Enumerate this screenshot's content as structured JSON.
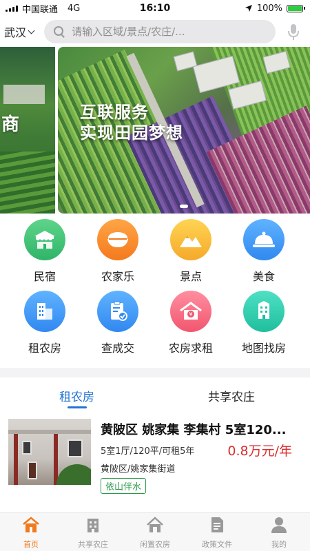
{
  "status_bar": {
    "carrier": "中国联通",
    "network": "4G",
    "time": "16:10",
    "battery": "100%"
  },
  "header": {
    "city": "武汉",
    "search_placeholder": "请输入区域/景点/农庄/...",
    "icons": [
      "search-icon",
      "microphone-icon",
      "chevron-down-icon"
    ]
  },
  "banner": {
    "side_text": "商",
    "title_line1": "互联服务",
    "title_line2": "实现田园梦想",
    "active_slide": 1,
    "slide_count": 2
  },
  "categories": [
    {
      "label": "民宿",
      "icon": "homestay-icon",
      "color": "#2fb568"
    },
    {
      "label": "农家乐",
      "icon": "rice-bowl-icon",
      "color": "#f47a1d"
    },
    {
      "label": "景点",
      "icon": "mountain-icon",
      "color": "#f5a92a"
    },
    {
      "label": "美食",
      "icon": "food-cloche-icon",
      "color": "#3188f0"
    },
    {
      "label": "租农房",
      "icon": "building-icon",
      "color": "#3188f0"
    },
    {
      "label": "查成交",
      "icon": "clipboard-check-icon",
      "color": "#3188f0"
    },
    {
      "label": "农房求租",
      "icon": "house-money-icon",
      "color": "#f1566f"
    },
    {
      "label": "地图找房",
      "icon": "map-building-icon",
      "color": "#1fbf9e"
    }
  ],
  "tabs": [
    {
      "label": "租农房",
      "active": true
    },
    {
      "label": "共享农庄",
      "active": false
    }
  ],
  "listing": {
    "title": "黄陂区 姚家集 李集村 5室120...",
    "specs": "5室1厅/120平/可租5年",
    "price": "0.8万元/年",
    "address": "黄陂区/姚家集街道",
    "tag": "依山伴水"
  },
  "bottom_nav": [
    {
      "label": "首页",
      "icon": "home-icon",
      "active": true
    },
    {
      "label": "共享农庄",
      "icon": "farm-building-icon",
      "active": false
    },
    {
      "label": "闲置农房",
      "icon": "house-icon",
      "active": false
    },
    {
      "label": "政策文件",
      "icon": "document-icon",
      "active": false
    },
    {
      "label": "我的",
      "icon": "profile-icon",
      "active": false
    }
  ],
  "colors": {
    "accent_blue": "#2273d6",
    "price_red": "#d9302f",
    "tag_green": "#2a9a4a",
    "nav_active": "#f07a1d"
  }
}
